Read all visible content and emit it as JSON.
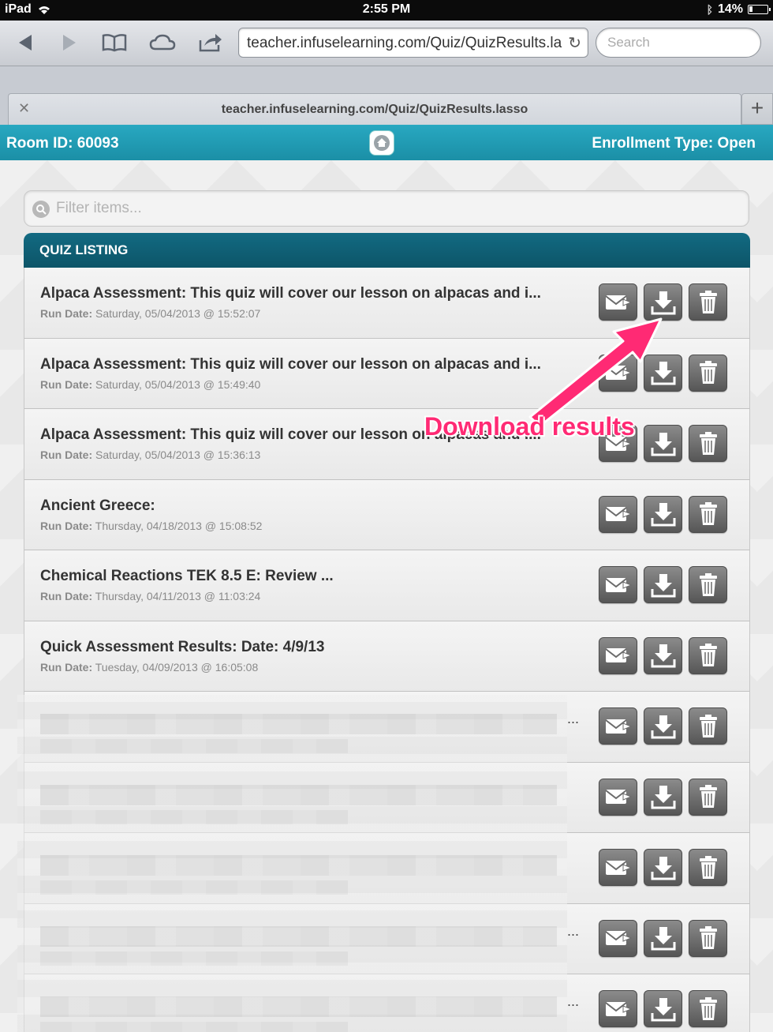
{
  "status_bar": {
    "device": "iPad",
    "time": "2:55 PM",
    "battery": "14%"
  },
  "browser": {
    "url": "teacher.infuselearning.com/Quiz/QuizResults.la",
    "search_placeholder": "Search",
    "tab_title": "teacher.infuselearning.com/Quiz/QuizResults.lasso"
  },
  "room_bar": {
    "room_id": "Room ID: 60093",
    "enrollment": "Enrollment Type: Open"
  },
  "filter": {
    "placeholder": "Filter items..."
  },
  "listing": {
    "header": "QUIZ LISTING",
    "run_date_label": "Run Date:",
    "items": [
      {
        "title": "Alpaca Assessment: This quiz will cover our lesson on alpacas and i...",
        "date": "Saturday, 05/04/2013 @ 15:52:07"
      },
      {
        "title": "Alpaca Assessment: This quiz will cover our lesson on alpacas and i...",
        "date": "Saturday, 05/04/2013 @ 15:49:40"
      },
      {
        "title": "Alpaca Assessment: This quiz will cover our lesson on alpacas and i...",
        "date": "Saturday, 05/04/2013 @ 15:36:13"
      },
      {
        "title": "Ancient Greece:",
        "date": "Thursday, 04/18/2013 @ 15:08:52"
      },
      {
        "title": "Chemical Reactions TEK 8.5 E: Review ...",
        "date": "Thursday, 04/11/2013 @ 11:03:24"
      },
      {
        "title": "Quick Assessment Results: Date: 4/9/13",
        "date": "Tuesday, 04/09/2013 @ 16:05:08"
      }
    ],
    "blurred_dots": "..."
  },
  "annotation": {
    "text": "Download results",
    "color": "#ff2a74"
  }
}
